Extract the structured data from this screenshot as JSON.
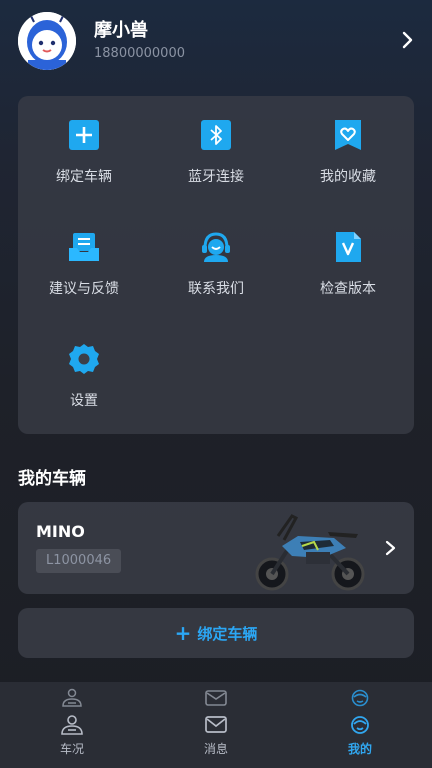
{
  "profile": {
    "name": "摩小兽",
    "phone": "18800000000"
  },
  "menu": {
    "items": [
      {
        "label": "绑定车辆",
        "icon": "plus-icon"
      },
      {
        "label": "蓝牙连接",
        "icon": "bluetooth-icon"
      },
      {
        "label": "我的收藏",
        "icon": "favorite-icon"
      },
      {
        "label": "建议与反馈",
        "icon": "feedback-icon"
      },
      {
        "label": "联系我们",
        "icon": "customer-service-icon"
      },
      {
        "label": "检查版本",
        "icon": "version-icon"
      },
      {
        "label": "设置",
        "icon": "settings-gear-icon"
      }
    ]
  },
  "vehicles": {
    "title": "我的车辆",
    "items": [
      {
        "name": "MINO",
        "id": "L1000046"
      }
    ],
    "bind_label": "绑定车辆"
  },
  "tabbar": {
    "tabs": [
      {
        "label": "车况",
        "icon": "vehicle-status-icon"
      },
      {
        "label": "消息",
        "icon": "mail-icon"
      },
      {
        "label": "我的",
        "icon": "profile-icon",
        "active": true
      }
    ]
  },
  "colors": {
    "accent": "#2ba7f5",
    "icon_blue": "#1fa8ef",
    "card": "#3c3f48"
  }
}
